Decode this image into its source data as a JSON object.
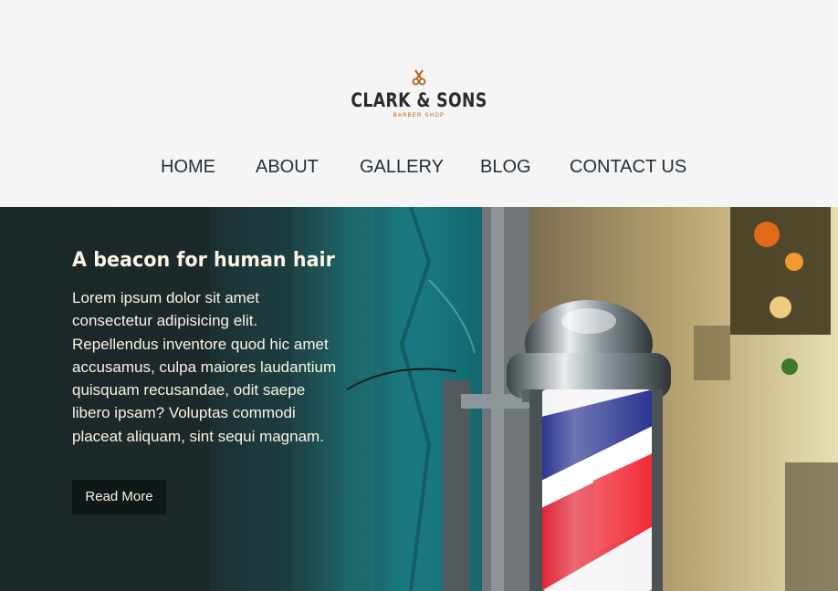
{
  "brand": {
    "name": "CLARK & SONS",
    "tagline": "BARBER SHOP",
    "logo_icon": "scissors-icon",
    "accent_color": "#b4621c"
  },
  "nav": {
    "items": [
      {
        "label": "HOME"
      },
      {
        "label": "ABOUT"
      },
      {
        "label": "GALLERY"
      },
      {
        "label": "BLOG"
      },
      {
        "label": "CONTACT US"
      }
    ]
  },
  "hero": {
    "title": "A beacon for human hair",
    "body": "Lorem ipsum dolor sit amet consectetur adipisicing elit. Repellendus inventore quod hic amet accusamus, culpa maiores laudantium quisquam recusandae, odit saepe libero ipsam? Voluptas commodi placeat aliquam, sint sequi magnam.",
    "cta_label": "Read More",
    "text_color": "#fbf3e4",
    "button_color": "#0f1818"
  }
}
